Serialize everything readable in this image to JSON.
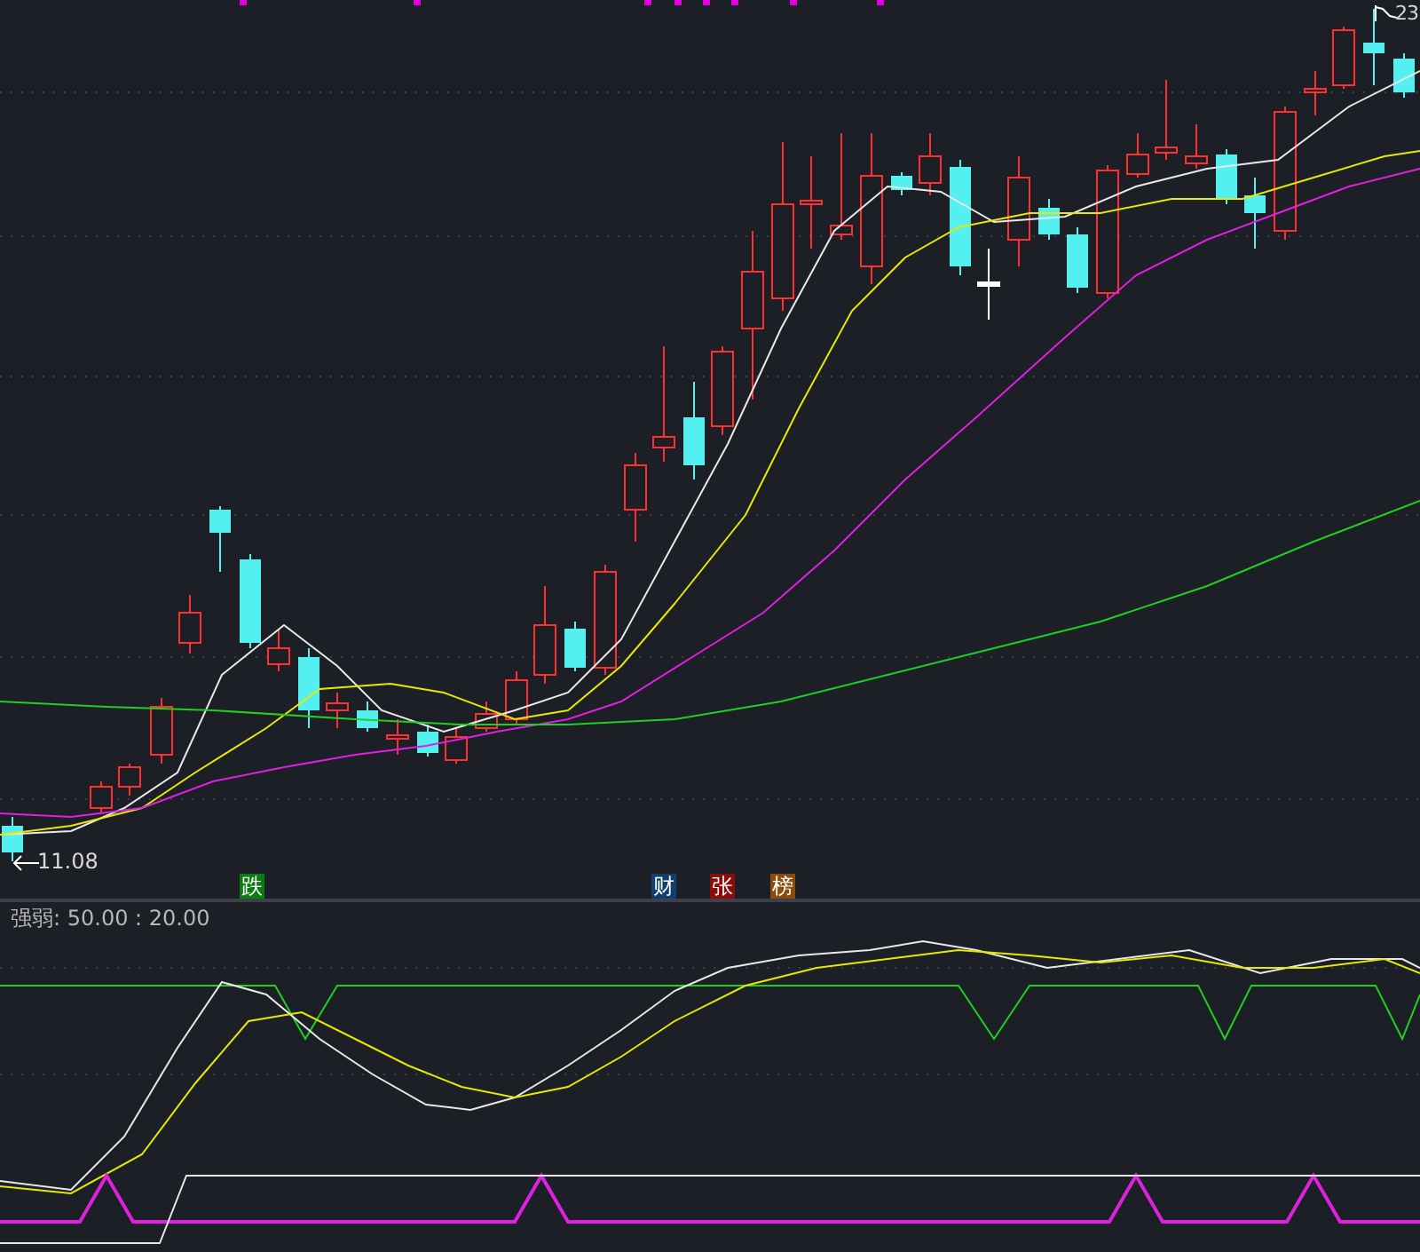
{
  "price_chart": {
    "low_marker": "11.08",
    "high_marker": "23"
  },
  "event_badges": [
    {
      "label": "跌",
      "color": "#0b7d12"
    },
    {
      "label": "财",
      "color": "#0e3f70"
    },
    {
      "label": "张",
      "color": "#8c0c0c"
    },
    {
      "label": "榜",
      "color": "#8a4a0c"
    }
  ],
  "indicator": {
    "label": "强弱: 50.00 : 20.00"
  }
}
